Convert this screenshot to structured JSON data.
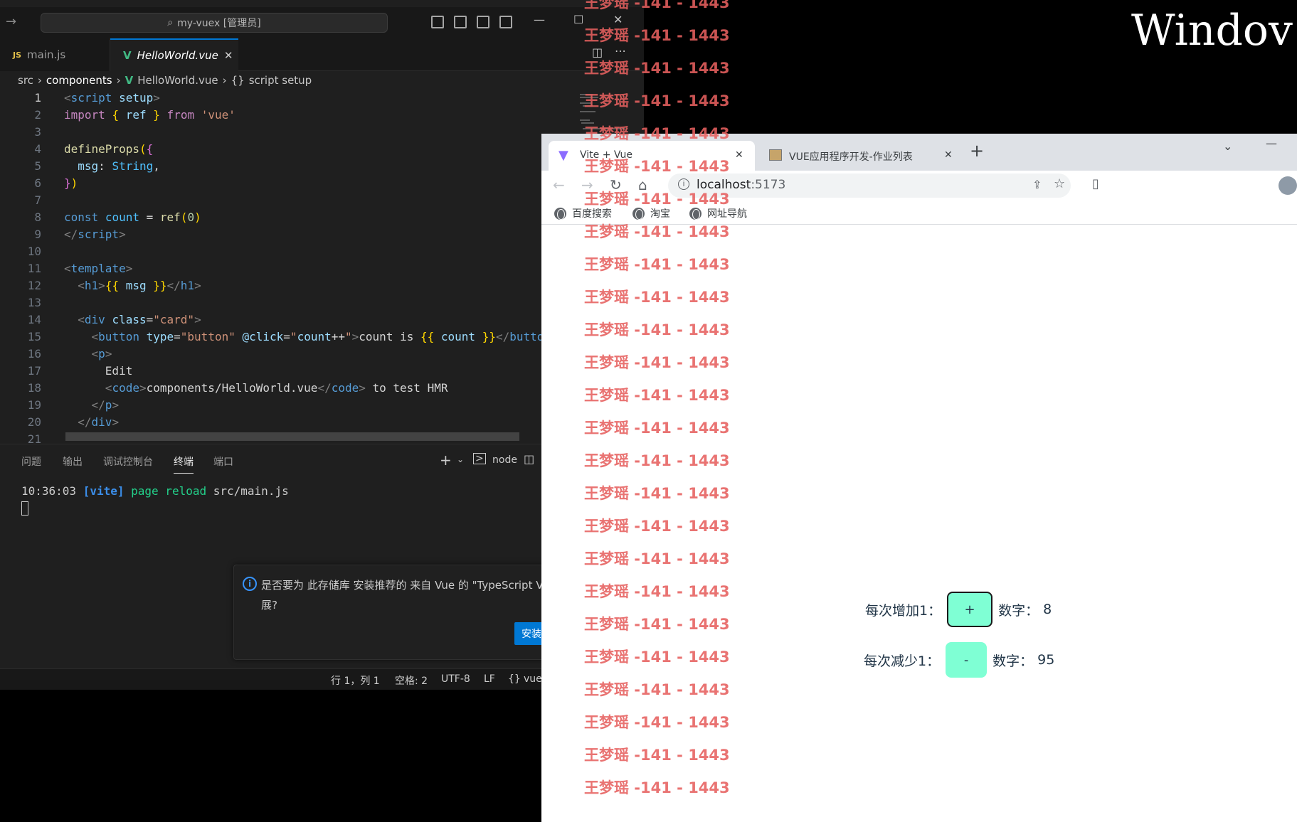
{
  "vscode": {
    "search_title": "my-vuex [管理员]",
    "tabs": [
      {
        "icon": "JS",
        "label": "main.js"
      },
      {
        "icon": "V",
        "label": "HelloWorld.vue"
      }
    ],
    "breadcrumb": [
      "src",
      "components",
      "HelloWorld.vue",
      "script setup"
    ],
    "line_numbers": [
      "1",
      "2",
      "3",
      "4",
      "5",
      "6",
      "7",
      "8",
      "9",
      "10",
      "11",
      "12",
      "13",
      "14",
      "15",
      "16",
      "17",
      "18",
      "19",
      "20",
      "21"
    ],
    "panel_tabs": [
      "问题",
      "输出",
      "调试控制台",
      "终端",
      "端口"
    ],
    "terminal_node": "node",
    "terminal_time": "10:36:03",
    "terminal_vite": "[vite]",
    "terminal_msg": "page reload",
    "terminal_file": "src/main.js",
    "notification": {
      "text": "是否要为 此存储库 安装推荐的 来自 Vue 的 \"TypeScript Vue Plugin (Volar)\" 扩展?",
      "install": "安装"
    },
    "status": {
      "position": "行 1，列 1",
      "spaces": "空格: 2",
      "encoding": "UTF-8",
      "eol": "LF",
      "language": "vue"
    }
  },
  "chrome": {
    "tabs": [
      {
        "label": "Vite + Vue"
      },
      {
        "label": "VUE应用程序开发-作业列表"
      }
    ],
    "url_host": "localhost",
    "url_port": ":5173",
    "bookmarks": [
      "百度搜索",
      "淘宝",
      "网址导航"
    ]
  },
  "app": {
    "inc_label": "每次增加1：",
    "inc_button": "+",
    "inc_value_label": "数字：",
    "inc_value": "8",
    "dec_label": "每次减少1：",
    "dec_button": "-",
    "dec_value_label": "数字：",
    "dec_value": "95"
  },
  "watermark": "王梦瑶 -141 - 1443",
  "desktop_text": "Windov",
  "colors": {
    "vs_bg": "#1f1f1f",
    "accent": "#0078d4",
    "button_bg": "#7fffd4",
    "watermark": "#e6605f"
  }
}
